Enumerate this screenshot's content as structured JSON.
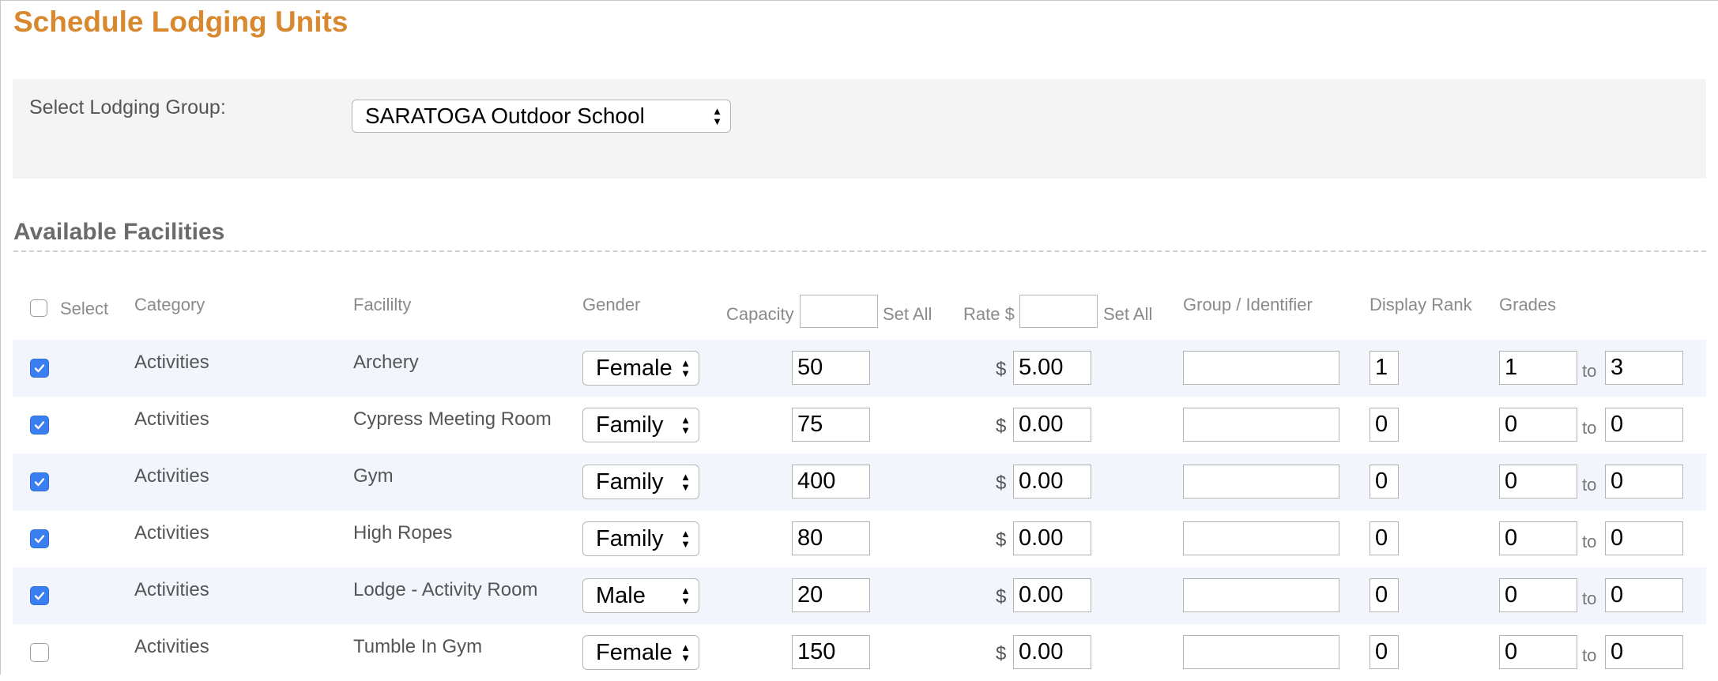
{
  "page": {
    "title": "Schedule Lodging Units"
  },
  "lodging_group": {
    "label": "Select Lodging Group:",
    "selected": "SARATOGA Outdoor School"
  },
  "facilities": {
    "section_title": "Available Facilities",
    "headers": {
      "select": "Select",
      "category": "Category",
      "facility": "Facililty",
      "gender": "Gender",
      "capacity": "Capacity",
      "set_all_capacity": "Set All",
      "rate": "Rate $",
      "set_all_rate": "Set All",
      "group_identifier": "Group / Identifier",
      "display_rank": "Display Rank",
      "grades": "Grades"
    },
    "currency_symbol": "$",
    "grade_to": "to",
    "colors": {
      "checkbox_checked": "#3b7ef0",
      "row_shade": "#f2f5fc",
      "title": "#d8892f"
    },
    "rows": [
      {
        "selected": true,
        "category": "Activities",
        "facility": "Archery",
        "gender": "Female",
        "capacity": "50",
        "rate": "5.00",
        "group_identifier": "",
        "display_rank": "1",
        "grade_from": "1",
        "grade_to": "3"
      },
      {
        "selected": true,
        "category": "Activities",
        "facility": "Cypress Meeting Room",
        "gender": "Family",
        "capacity": "75",
        "rate": "0.00",
        "group_identifier": "",
        "display_rank": "0",
        "grade_from": "0",
        "grade_to": "0"
      },
      {
        "selected": true,
        "category": "Activities",
        "facility": "Gym",
        "gender": "Family",
        "capacity": "400",
        "rate": "0.00",
        "group_identifier": "",
        "display_rank": "0",
        "grade_from": "0",
        "grade_to": "0"
      },
      {
        "selected": true,
        "category": "Activities",
        "facility": "High Ropes",
        "gender": "Family",
        "capacity": "80",
        "rate": "0.00",
        "group_identifier": "",
        "display_rank": "0",
        "grade_from": "0",
        "grade_to": "0"
      },
      {
        "selected": true,
        "category": "Activities",
        "facility": "Lodge - Activity Room",
        "gender": "Male",
        "capacity": "20",
        "rate": "0.00",
        "group_identifier": "",
        "display_rank": "0",
        "grade_from": "0",
        "grade_to": "0"
      },
      {
        "selected": false,
        "category": "Activities",
        "facility": "Tumble In Gym",
        "gender": "Female",
        "capacity": "150",
        "rate": "0.00",
        "group_identifier": "",
        "display_rank": "0",
        "grade_from": "0",
        "grade_to": "0"
      }
    ]
  }
}
